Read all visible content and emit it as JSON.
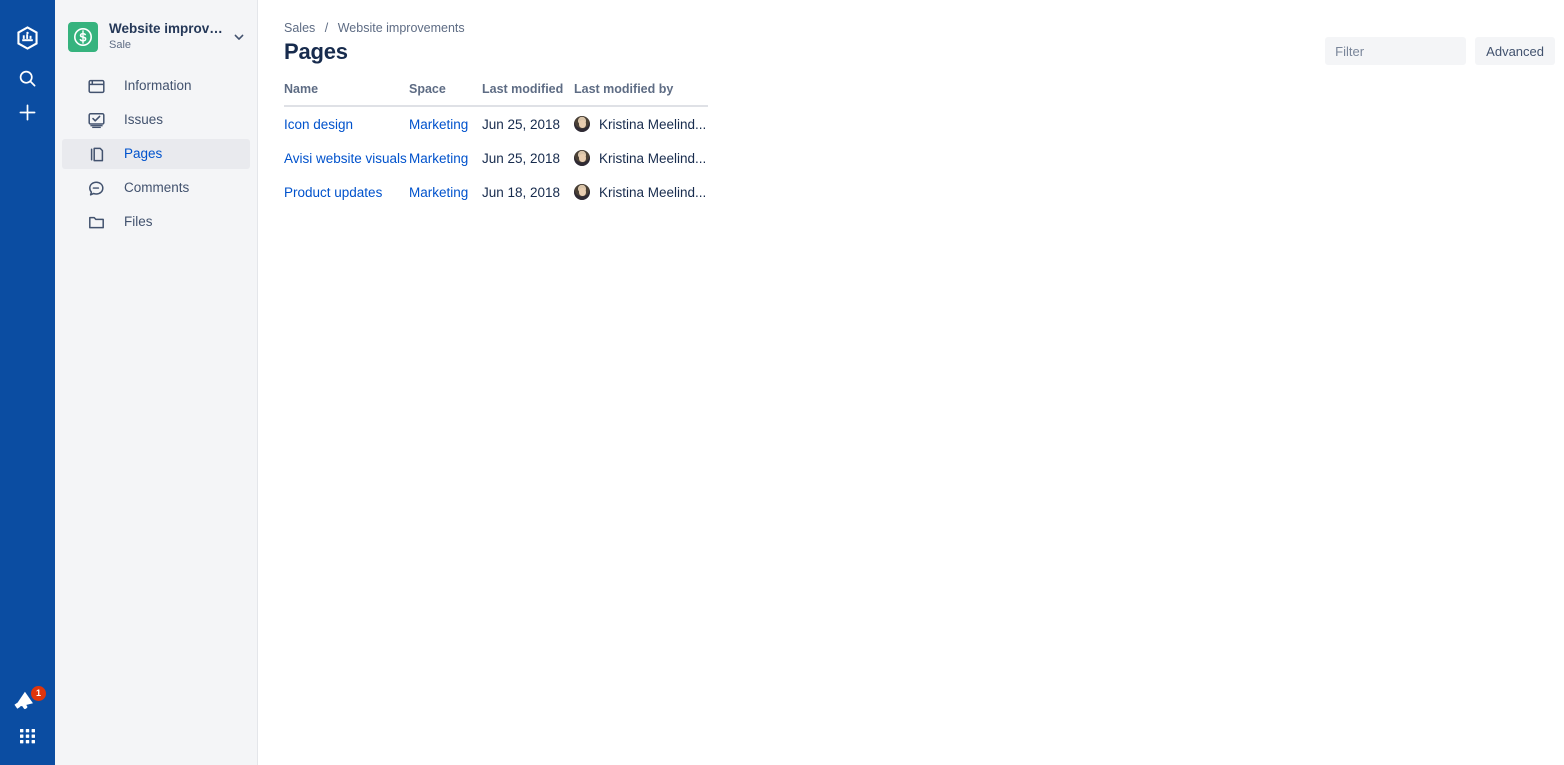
{
  "rail": {
    "logo_icon": "atlassian-jira-logo-icon",
    "search_icon": "search-icon",
    "add_icon": "plus-icon",
    "announcement_icon": "megaphone-icon",
    "announcement_badge": "1",
    "apps_icon": "app-switcher-grid-icon",
    "background_color": "#0B4DA2",
    "badge_color": "#DE350B"
  },
  "sidebar": {
    "project": {
      "avatar_icon": "dollar-circle-icon",
      "avatar_color": "#36B37E",
      "name": "Website improve...",
      "type": "Sale",
      "chevron_icon": "chevron-down-icon"
    },
    "items": [
      {
        "label": "Information",
        "icon": "browser-window-icon",
        "selected": false
      },
      {
        "label": "Issues",
        "icon": "issues-monitor-icon",
        "selected": false
      },
      {
        "label": "Pages",
        "icon": "pages-copy-icon",
        "selected": true
      },
      {
        "label": "Comments",
        "icon": "comment-bubble-icon",
        "selected": false
      },
      {
        "label": "Files",
        "icon": "folder-icon",
        "selected": false
      }
    ],
    "background_color": "#F4F5F7",
    "selected_color": "#0052CC"
  },
  "main": {
    "breadcrumb": {
      "root": "Sales",
      "separator": "/",
      "current": "Website improvements"
    },
    "title": "Pages",
    "toolbar": {
      "filter_placeholder": "Filter",
      "filter_value": "",
      "advanced_label": "Advanced"
    },
    "table": {
      "columns": [
        "Name",
        "Space",
        "Last modified",
        "Last modified by"
      ],
      "rows": [
        {
          "name": "Icon design",
          "space": "Marketing",
          "last_modified": "Jun 25, 2018",
          "last_modified_by": "Kristina Meelind...",
          "avatar_icon": "user-avatar"
        },
        {
          "name": "Avisi website visuals",
          "space": "Marketing",
          "last_modified": "Jun 25, 2018",
          "last_modified_by": "Kristina Meelind...",
          "avatar_icon": "user-avatar"
        },
        {
          "name": "Product updates",
          "space": "Marketing",
          "last_modified": "Jun 18, 2018",
          "last_modified_by": "Kristina Meelind...",
          "avatar_icon": "user-avatar"
        }
      ]
    }
  }
}
